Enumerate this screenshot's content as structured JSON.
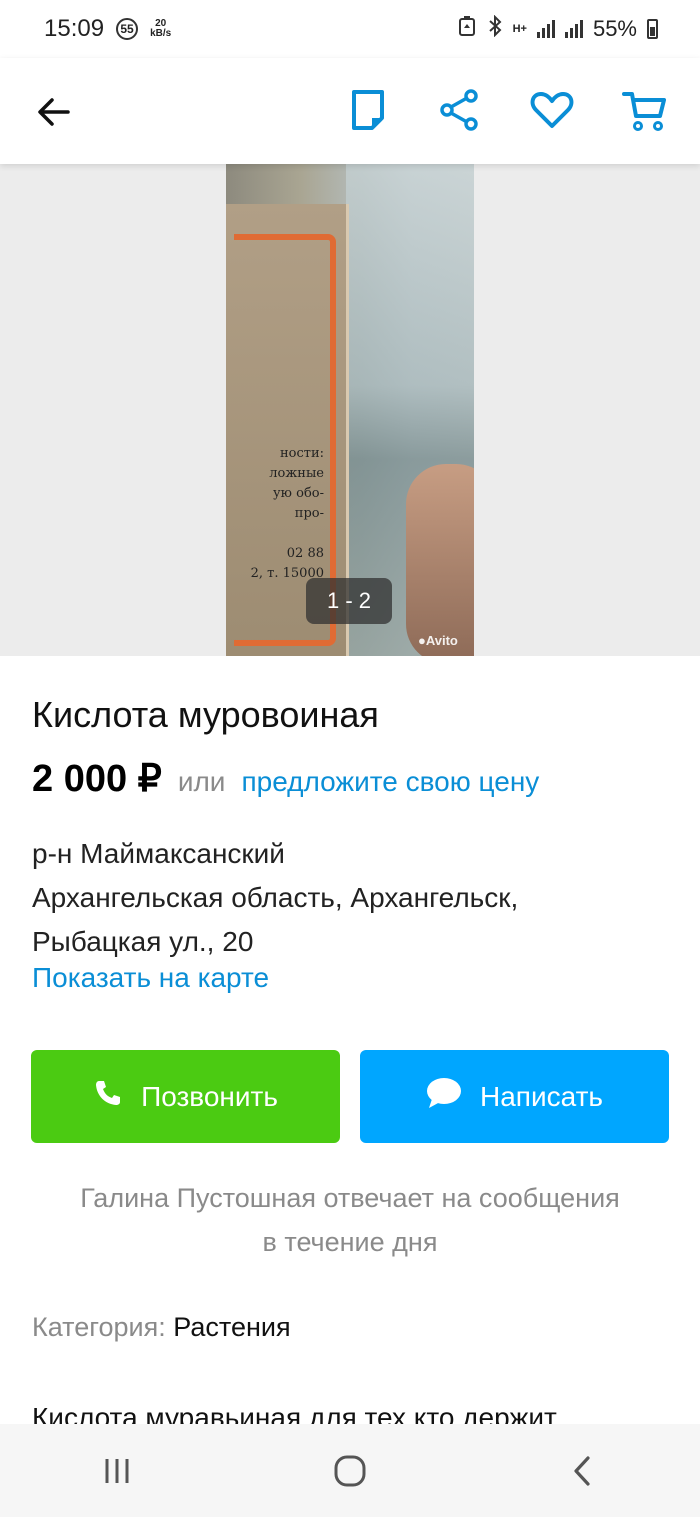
{
  "status_bar": {
    "time": "15:09",
    "notif_count": "55",
    "speed_value": "20",
    "speed_unit": "kB/s",
    "network_label": "H+",
    "battery": "55%"
  },
  "app_bar": {
    "back_icon": "arrow-left-icon",
    "icons": [
      "note-icon",
      "share-icon",
      "heart-icon",
      "cart-icon"
    ],
    "accent_color": "#0a8ed6"
  },
  "gallery": {
    "counter": "1 - 2",
    "watermark": "Avito",
    "label_text": [
      "ности:",
      "ложные",
      "ую обо-",
      "про-",
      "",
      "02 88",
      "2, т. 15000"
    ]
  },
  "listing": {
    "title": "Кислота муровоиная",
    "price": "2 000 ₽",
    "or_text": "или",
    "offer_link": "предложите свою цену",
    "district": "р-н Маймаксанский",
    "address_line1": "Архангельская область, Архангельск,",
    "address_line2": "Рыбацкая ул., 20",
    "map_link": "Показать на карте"
  },
  "actions": {
    "call_label": "Позвонить",
    "write_label": "Написать",
    "call_color": "#4bcb12",
    "write_color": "#00a6ff"
  },
  "seller": {
    "response_line1": "Галина Пустошная отвечает на сообщения",
    "response_line2": "в течение дня"
  },
  "category": {
    "label": "Категория:",
    "value": "Растения"
  },
  "description": {
    "text": "Кислота муравьиная для тех кто держит"
  },
  "nav_bar": {
    "icons": [
      "recent-apps-icon",
      "home-icon",
      "back-icon"
    ]
  }
}
